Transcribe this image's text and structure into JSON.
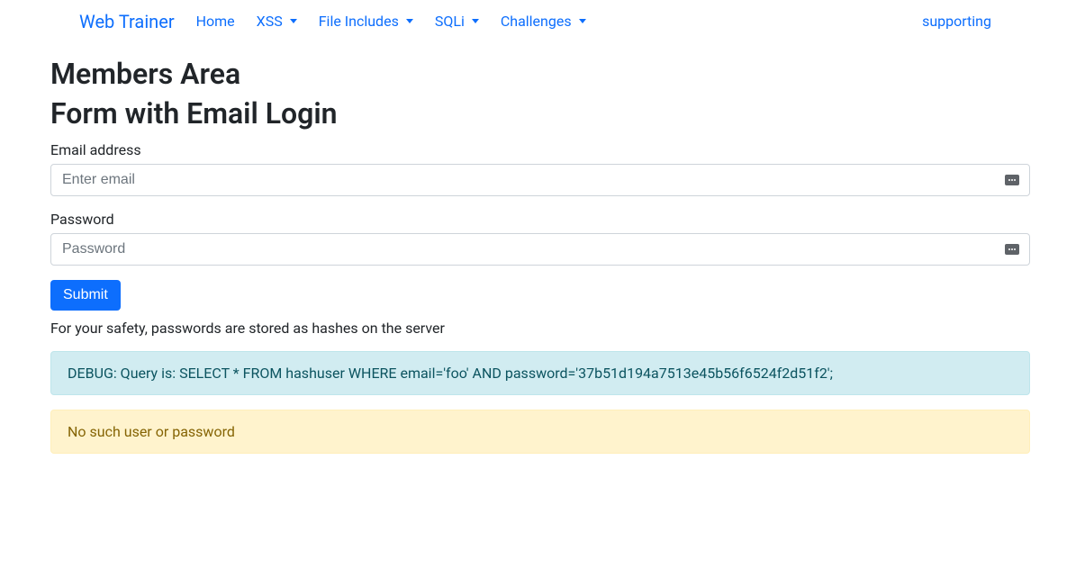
{
  "nav": {
    "brand": "Web Trainer",
    "items": [
      {
        "label": "Home",
        "dropdown": false
      },
      {
        "label": "XSS",
        "dropdown": true
      },
      {
        "label": "File Includes",
        "dropdown": true
      },
      {
        "label": "SQLi",
        "dropdown": true
      },
      {
        "label": "Challenges",
        "dropdown": true
      }
    ],
    "right": "supporting"
  },
  "page": {
    "title1": "Members Area",
    "title2": "Form with Email Login"
  },
  "form": {
    "email_label": "Email address",
    "email_placeholder": "Enter email",
    "password_label": "Password",
    "password_placeholder": "Password",
    "submit": "Submit",
    "note": "For your safety, passwords are stored as hashes on the server"
  },
  "alerts": {
    "debug": "DEBUG: Query is: SELECT * FROM hashuser WHERE email='foo' AND password='37b51d194a7513e45b56f6524f2d51f2';",
    "warning": "No such user or password"
  }
}
